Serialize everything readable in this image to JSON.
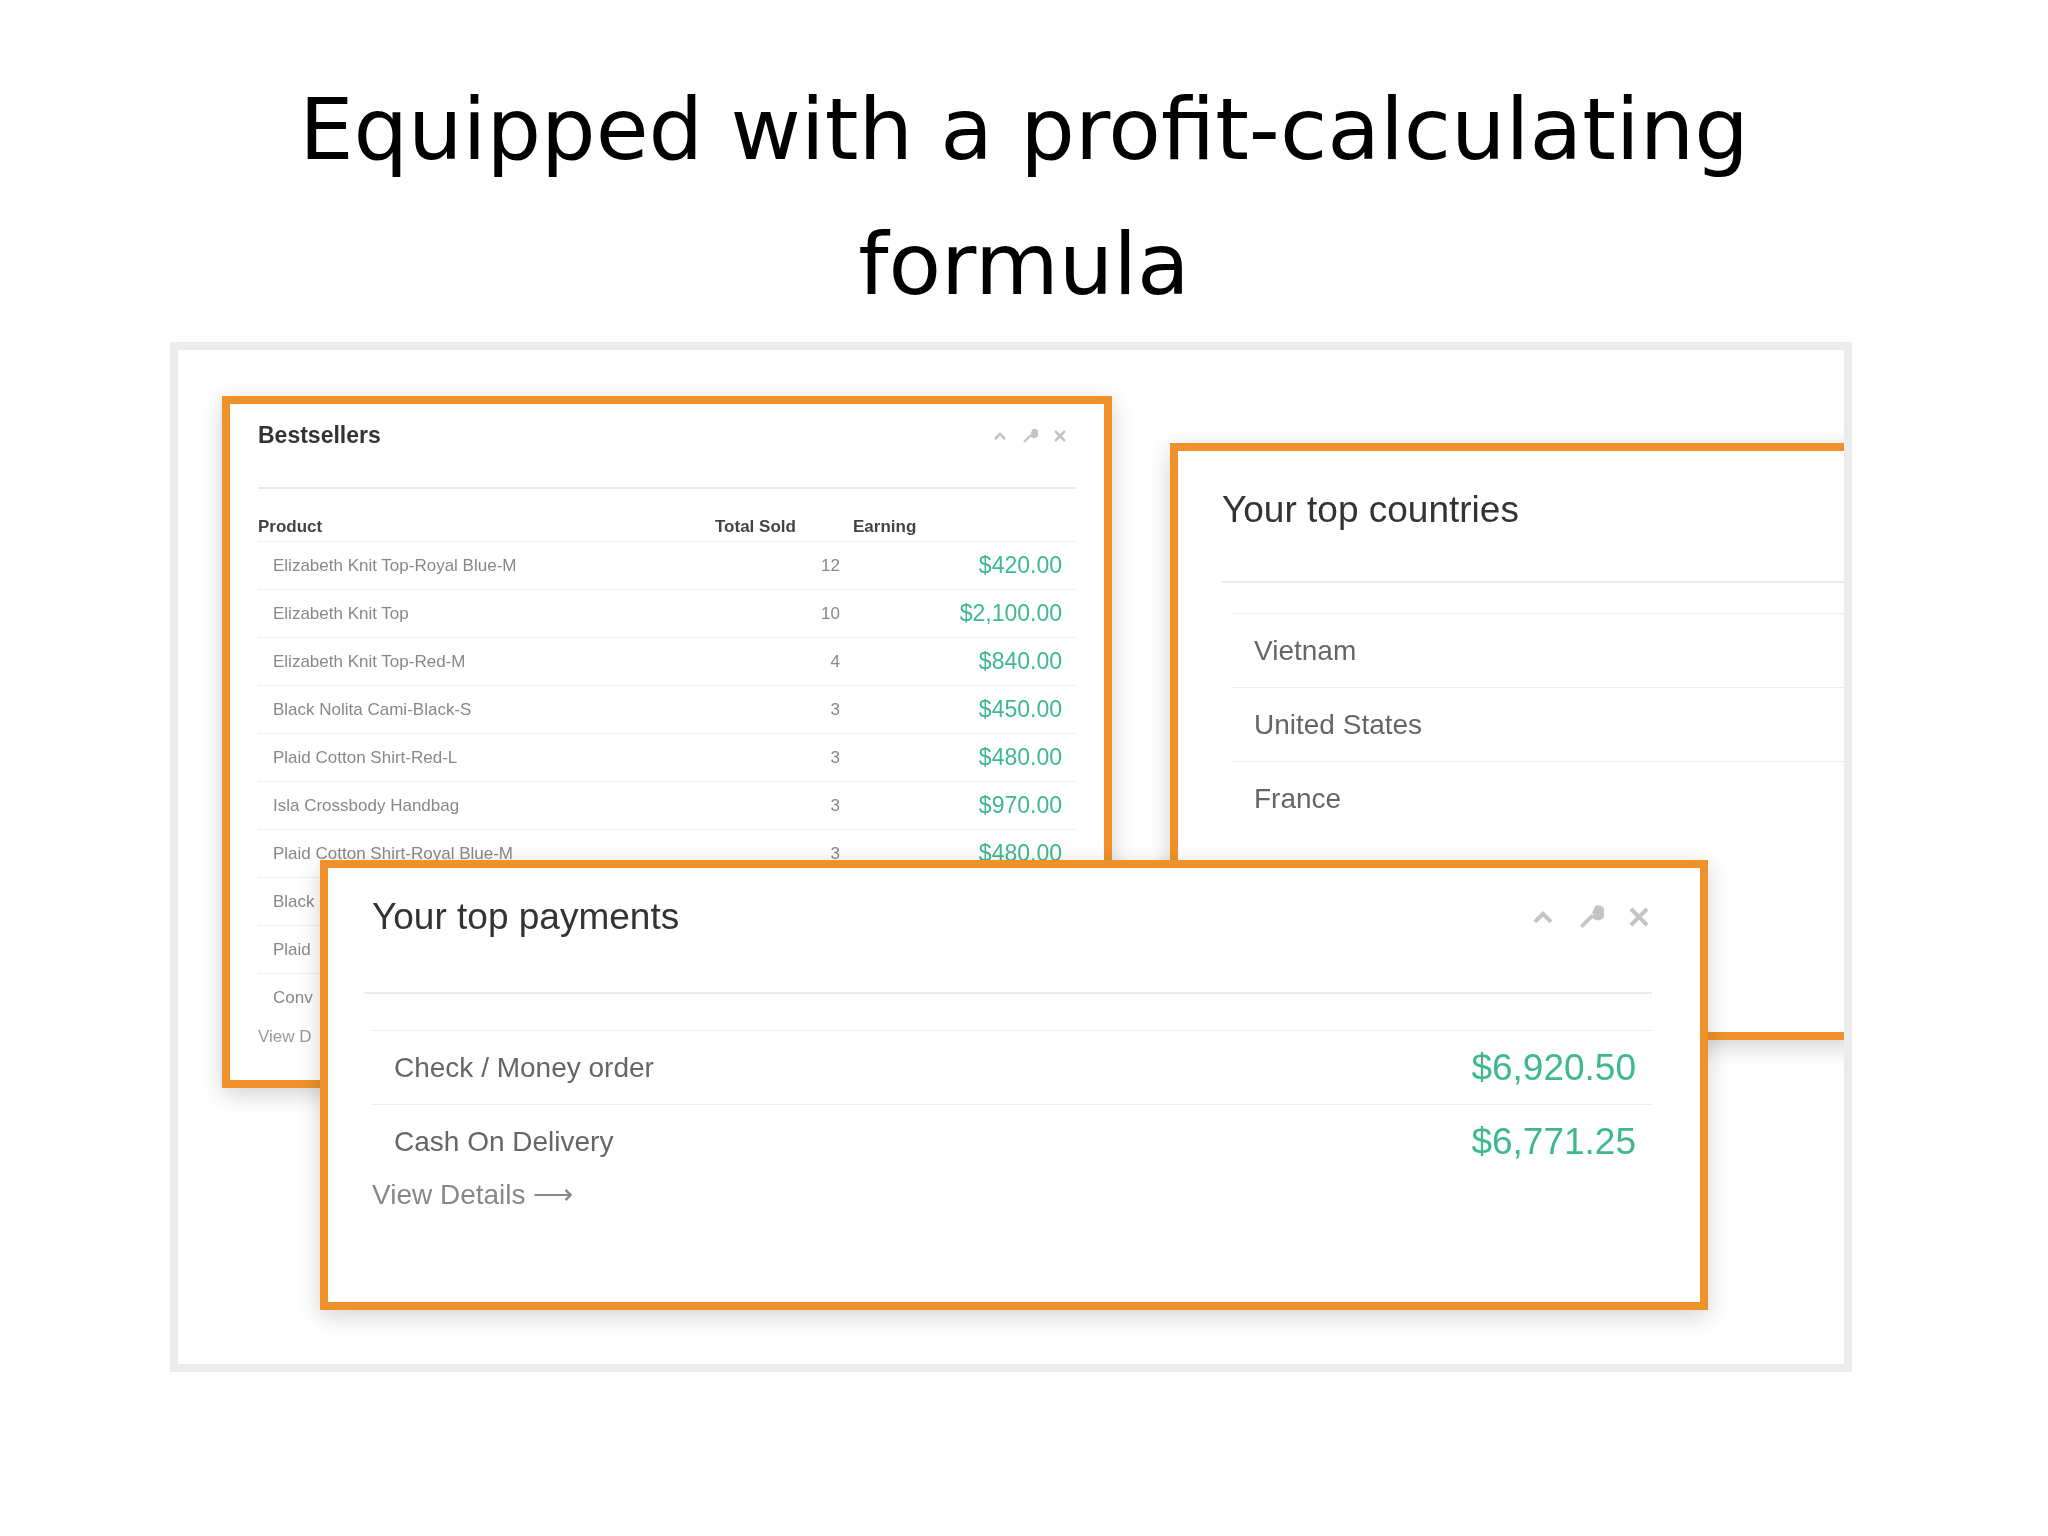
{
  "slide": {
    "title": "Equipped with a profit-calculating formula"
  },
  "bestsellers": {
    "title": "Bestsellers",
    "columns": [
      "Product",
      "Total Sold",
      "Earning"
    ],
    "rows": [
      {
        "product": "Elizabeth Knit Top-Royal Blue-M",
        "total_sold": "12",
        "earning": "$420.00"
      },
      {
        "product": "Elizabeth Knit Top",
        "total_sold": "10",
        "earning": "$2,100.00"
      },
      {
        "product": "Elizabeth Knit Top-Red-M",
        "total_sold": "4",
        "earning": "$840.00"
      },
      {
        "product": "Black Nolita Cami-Black-S",
        "total_sold": "3",
        "earning": "$450.00"
      },
      {
        "product": "Plaid Cotton Shirt-Red-L",
        "total_sold": "3",
        "earning": "$480.00"
      },
      {
        "product": "Isla Crossbody Handbag",
        "total_sold": "3",
        "earning": "$970.00"
      },
      {
        "product": "Plaid Cotton Shirt-Royal Blue-M",
        "total_sold": "3",
        "earning": "$480.00"
      },
      {
        "product": "Black"
      },
      {
        "product": "Plaid"
      },
      {
        "product": "Conv"
      }
    ],
    "footer_link": "View D"
  },
  "top_countries": {
    "title": "Your top countries",
    "rows": [
      "Vietnam",
      "United States",
      "France"
    ]
  },
  "top_payments": {
    "title": "Your top payments",
    "rows": [
      {
        "method": "Check / Money order",
        "amount": "$6,920.50"
      },
      {
        "method": "Cash On Delivery",
        "amount": "$6,771.25"
      }
    ],
    "footer_link": "View Details ⟶"
  }
}
